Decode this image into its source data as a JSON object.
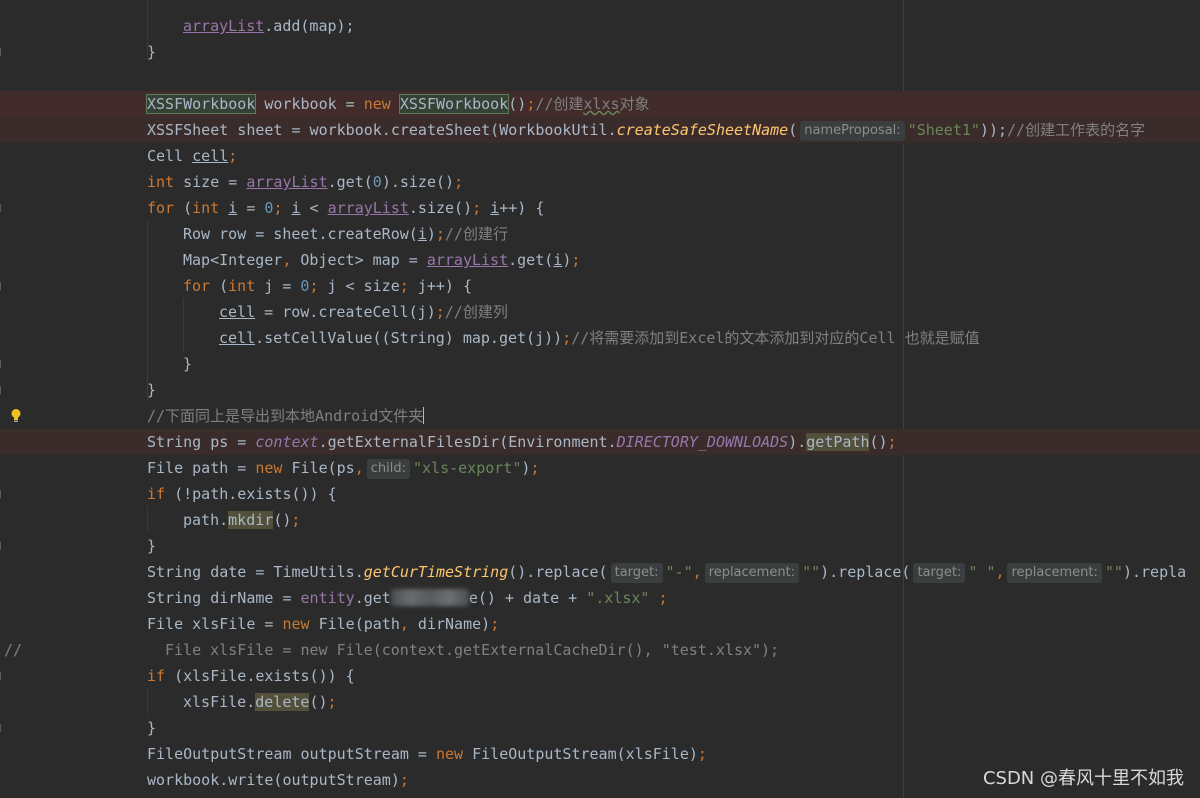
{
  "editor": {
    "language": "Java",
    "theme": "Darcula",
    "colors": {
      "background": "#2b2b2b",
      "keyword": "#cc7832",
      "string": "#6a8759",
      "number": "#6897bb",
      "comment": "#808080",
      "field": "#9876aa",
      "method": "#ffc66d",
      "default": "#a9b7c6",
      "error_line": "#3b2c2c"
    },
    "gutter": {
      "line_comment_marker": "//",
      "intention_icon": "lightbulb-icon"
    }
  },
  "code": {
    "l01": {
      "var": "arrayList",
      "rest": ".add(map);"
    },
    "l02": {
      "brace": "}"
    },
    "l03": {
      "type1": "XSSFWorkbook",
      "mid": " workbook = ",
      "kw": "new",
      "sp": " ",
      "type2": "XSSFWorkbook",
      "paren": "()",
      "semi": ";",
      "comment_a": "//创建",
      "comment_b": "xlxs",
      "comment_c": "对象"
    },
    "l04": {
      "a": "XSSFSheet sheet = workbook.createSheet(WorkbookUtil.",
      "method": "createSafeSheetName",
      "paren": "(",
      "hint": "nameProposal:",
      "str": "\"Sheet1\"",
      "close": "));",
      "comment": "//创建工作表的名字"
    },
    "l05": {
      "a": "Cell ",
      "var": "cell",
      "semi": ";"
    },
    "l06": {
      "kw": "int",
      "a": " size = ",
      "var_a": "ar",
      "var_b": "rayList",
      "b": ".get(",
      "num": "0",
      "c": ").size()",
      "semi": ";"
    },
    "l07": {
      "kw": "for",
      "a": " (",
      "kw2": "int",
      "sp": " ",
      "var1": "i",
      "b": " = ",
      "num": "0",
      "semi1": ";",
      "sp2": " ",
      "var2": "i",
      "c": " < ",
      "var3": "arrayList",
      "d": ".size()",
      "semi2": ";",
      "sp3": " ",
      "var4": "i",
      "e": "++) {"
    },
    "l08": {
      "a": "Row row = sheet.createRow(",
      "var": "i",
      "b": ")",
      "semi": ";",
      "comment": "//创建行"
    },
    "l09": {
      "a": "Map<Integer",
      "comma": ",",
      "b": " Object> map = ",
      "var": "arrayList",
      "c": ".get(",
      "var2": "i",
      "d": ")",
      "semi": ";"
    },
    "l10": {
      "kw": "for",
      "a": " (",
      "kw2": "int",
      "b": " j = ",
      "num": "0",
      "semi1": ";",
      "c": " j < size",
      "semi2": ";",
      "d": " j++) {"
    },
    "l11": {
      "var": "cell",
      "a": " = row.createCell(j)",
      "semi": ";",
      "comment": "//创建列"
    },
    "l12": {
      "var": "cell",
      "a": ".setCellValue((String) map.get(j))",
      "semi": ";",
      "comment": "//将需要添加到Excel的文本添加到对应的Cell 也就是赋值"
    },
    "l13": {
      "brace": "}"
    },
    "l14": {
      "brace": "}"
    },
    "l15": {
      "comment": "//下面同上是导出到本地Android文件夹"
    },
    "l16": {
      "a": "String ps = ",
      "ctx": "context",
      "b": ".getExternalFilesDir(Environment.",
      "const": "DIRECTORY_DOWNLOADS",
      "c": ").",
      "method": "getPath",
      "d": "()",
      "semi": ";"
    },
    "l17": {
      "a": "File path = ",
      "kw": "new",
      "b": " File(ps",
      "comma": ",",
      "hint": "child:",
      "str": "\"xls-export\"",
      "c": ")",
      "semi": ";"
    },
    "l18": {
      "kw": "if",
      "a": " (!path.exists()) {"
    },
    "l19": {
      "a": "path.",
      "method": "mkdir",
      "b": "()",
      "semi": ";"
    },
    "l20": {
      "brace": "}"
    },
    "l21": {
      "a": "String date = TimeUtils.",
      "method": "getCurTimeString",
      "b": "().replace(",
      "hint1": "target:",
      "str1": "\"-\"",
      "comma1": ",",
      "hint2": "replacement:",
      "str2": "\"\"",
      "c": ").replace(",
      "hint3": "target:",
      "str3": "\" \"",
      "comma2": ",",
      "hint4": "replacement:",
      "str4": "\"\"",
      "d": ").repla"
    },
    "l22": {
      "a": "String dirName = ",
      "fld": "entity",
      "b": ".get",
      "c": "e() + date + ",
      "str": "\".xlsx\"",
      "sp": " ",
      "semi": ";"
    },
    "l23": {
      "a": "File xlsFile = ",
      "kw": "new",
      "b": " File(path",
      "comma": ",",
      "c": " dirName)",
      "semi": ";"
    },
    "l24": {
      "text": "File xlsFile = new File(context.getExternalCacheDir(), \"test.xlsx\");"
    },
    "l25": {
      "kw": "if",
      "a": " (xlsFile.exists()) {"
    },
    "l26": {
      "a": "xlsFile.",
      "method": "delete",
      "b": "()",
      "semi": ";"
    },
    "l27": {
      "brace": "}"
    },
    "l28": {
      "a": "FileOutputStream outputStream = ",
      "kw": "new",
      "b": " FileOutputStream(xlsFile)",
      "semi": ";"
    },
    "l29": {
      "a": "workbook.write(outputStream)",
      "semi": ";"
    }
  },
  "watermark": "CSDN @春风十里不如我"
}
